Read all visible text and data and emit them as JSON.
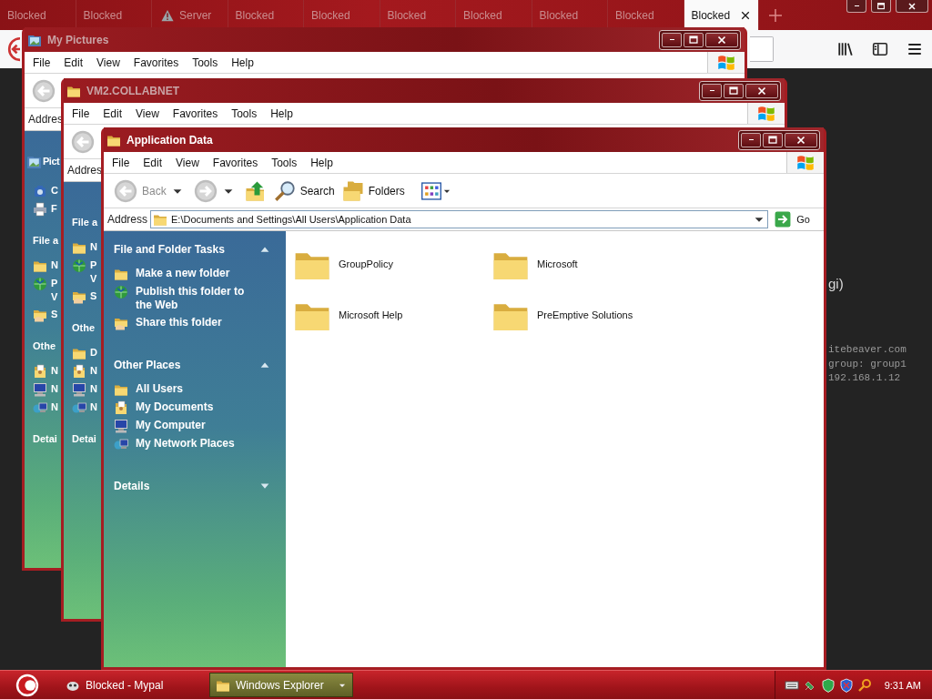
{
  "browser": {
    "tabs": [
      {
        "label": "Blocked",
        "selected": false,
        "warning": false
      },
      {
        "label": "Blocked",
        "selected": false,
        "warning": false
      },
      {
        "label": "Server",
        "selected": false,
        "warning": true
      },
      {
        "label": "Blocked",
        "selected": false,
        "warning": false
      },
      {
        "label": "Blocked",
        "selected": false,
        "warning": false
      },
      {
        "label": "Blocked",
        "selected": false,
        "warning": false
      },
      {
        "label": "Blocked",
        "selected": false,
        "warning": false
      },
      {
        "label": "Blocked",
        "selected": false,
        "warning": false
      },
      {
        "label": "Blocked",
        "selected": false,
        "warning": false
      },
      {
        "label": "Blocked",
        "selected": true,
        "warning": false
      }
    ]
  },
  "page": {
    "fragment": "gi)",
    "console_lines": [
      "itebeaver.com",
      "group: group1",
      "192.168.1.12"
    ]
  },
  "windows": [
    {
      "title": "My Pictures",
      "active": false,
      "menu": [
        "File",
        "Edit",
        "View",
        "Favorites",
        "Tools",
        "Help"
      ],
      "address_label": "Addres",
      "panel": [
        {
          "kind": "banner",
          "text": "Pict"
        },
        {
          "kind": "camera",
          "lines": [
            "C"
          ]
        },
        {
          "kind": "printer",
          "lines": [
            "F"
          ]
        },
        {
          "kind": "heading",
          "text": "File a"
        },
        {
          "kind": "folder",
          "lines": [
            "N"
          ]
        },
        {
          "kind": "globe",
          "lines": [
            "P",
            "V"
          ]
        },
        {
          "kind": "share",
          "lines": [
            "S"
          ]
        },
        {
          "kind": "heading",
          "text": "Othe"
        },
        {
          "kind": "docs",
          "lines": [
            "N"
          ]
        },
        {
          "kind": "computer",
          "lines": [
            "N"
          ]
        },
        {
          "kind": "network",
          "lines": [
            "N"
          ]
        },
        {
          "kind": "heading",
          "text": "Detai"
        }
      ]
    },
    {
      "title": "VM2.COLLABNET",
      "active": false,
      "menu": [
        "File",
        "Edit",
        "View",
        "Favorites",
        "Tools",
        "Help"
      ],
      "address_label": "Addres",
      "panel": [
        {
          "kind": "heading",
          "text": "File a"
        },
        {
          "kind": "folder",
          "lines": [
            "N"
          ]
        },
        {
          "kind": "globe",
          "lines": [
            "P",
            "V"
          ]
        },
        {
          "kind": "share",
          "lines": [
            "S"
          ]
        },
        {
          "kind": "heading",
          "text": "Othe"
        },
        {
          "kind": "folder",
          "lines": [
            "D"
          ]
        },
        {
          "kind": "docs",
          "lines": [
            "N"
          ]
        },
        {
          "kind": "computer",
          "lines": [
            "N"
          ]
        },
        {
          "kind": "network",
          "lines": [
            "N"
          ]
        },
        {
          "kind": "heading",
          "text": "Detai"
        }
      ]
    }
  ],
  "explorer": {
    "title": "Application Data",
    "active": true,
    "menu": [
      "File",
      "Edit",
      "View",
      "Favorites",
      "Tools",
      "Help"
    ],
    "toolbar": {
      "back": "Back",
      "search": "Search",
      "folders": "Folders"
    },
    "address": {
      "label": "Address",
      "path": "E:\\Documents and Settings\\All Users\\Application Data",
      "go": "Go"
    },
    "sections": [
      {
        "title": "File and Folder Tasks",
        "expanded": true,
        "items": [
          {
            "kind": "folder",
            "label": "Make a new folder"
          },
          {
            "kind": "globe",
            "label": "Publish this folder to the Web"
          },
          {
            "kind": "share",
            "label": "Share this folder"
          }
        ]
      },
      {
        "title": "Other Places",
        "expanded": true,
        "items": [
          {
            "kind": "folder",
            "label": "All Users"
          },
          {
            "kind": "docs",
            "label": "My Documents"
          },
          {
            "kind": "computer",
            "label": "My Computer"
          },
          {
            "kind": "network",
            "label": "My Network Places"
          }
        ]
      },
      {
        "title": "Details",
        "expanded": false
      }
    ],
    "items": [
      {
        "name": "GroupPolicy"
      },
      {
        "name": "Microsoft"
      },
      {
        "name": "Microsoft Help"
      },
      {
        "name": "PreEmptive Solutions"
      }
    ]
  },
  "taskbar": {
    "tasks": [
      {
        "label": "Blocked - Mypal",
        "kind": "browser",
        "selected": false
      },
      {
        "label": "Windows Explorer",
        "kind": "folder",
        "selected": true
      }
    ],
    "clock": "9:31 AM"
  }
}
